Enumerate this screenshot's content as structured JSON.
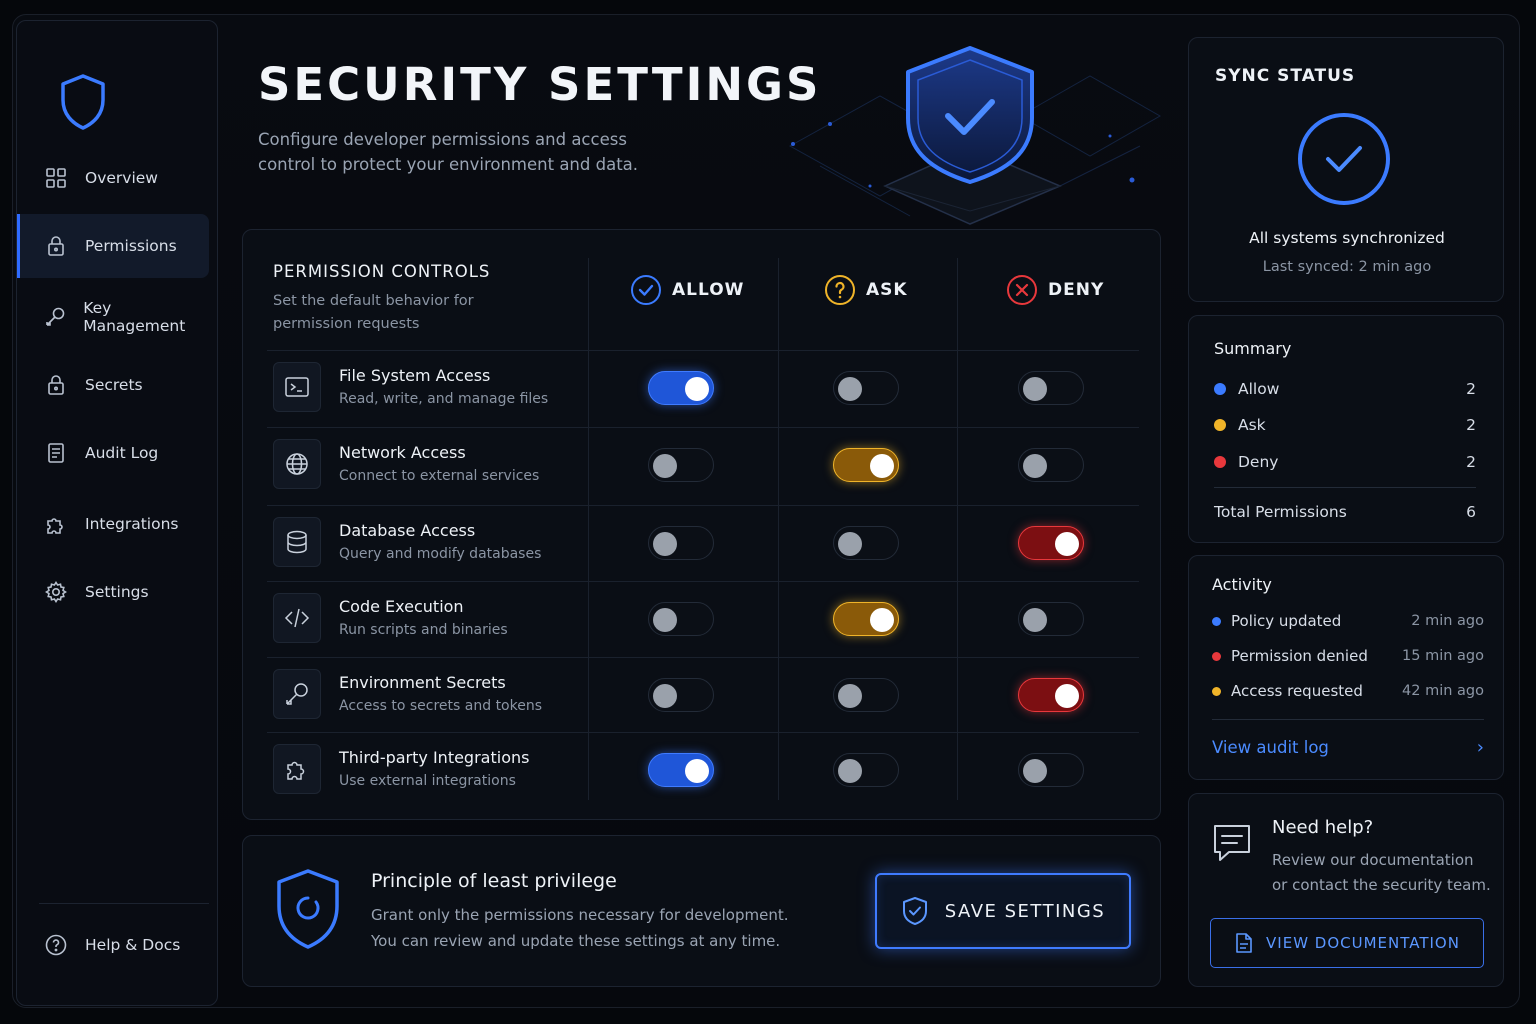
{
  "header": {
    "title": "SECURITY SETTINGS",
    "subtitle": "Configure developer permissions and access control to protect your environment and data."
  },
  "sidebar": {
    "items": [
      {
        "label": "Overview",
        "icon": "grid-icon"
      },
      {
        "label": "Permissions",
        "icon": "lock-icon",
        "active": true
      },
      {
        "label": "Key Management",
        "icon": "key-icon"
      },
      {
        "label": "Secrets",
        "icon": "lock-icon"
      },
      {
        "label": "Audit Log",
        "icon": "document-icon"
      },
      {
        "label": "Integrations",
        "icon": "puzzle-icon"
      },
      {
        "label": "Settings",
        "icon": "gear-icon"
      }
    ],
    "help_label": "Help & Docs"
  },
  "permissions": {
    "title": "PERMISSION CONTROLS",
    "subtitle": "Set the default behavior for permission requests",
    "columns": {
      "allow": "ALLOW",
      "ask": "ASK",
      "deny": "DENY"
    },
    "rows": [
      {
        "name": "File System Access",
        "desc": "Read, write, and manage files",
        "icon": "terminal-icon",
        "setting": "allow"
      },
      {
        "name": "Network Access",
        "desc": "Connect to external services",
        "icon": "globe-icon",
        "setting": "ask"
      },
      {
        "name": "Database Access",
        "desc": "Query and modify databases",
        "icon": "database-icon",
        "setting": "deny"
      },
      {
        "name": "Code Execution",
        "desc": "Run scripts and binaries",
        "icon": "code-icon",
        "setting": "ask"
      },
      {
        "name": "Environment Secrets",
        "desc": "Access to secrets and tokens",
        "icon": "key-icon",
        "setting": "deny"
      },
      {
        "name": "Third-party Integrations",
        "desc": "Use external integrations",
        "icon": "puzzle-icon",
        "setting": "allow"
      }
    ]
  },
  "info": {
    "title": "Principle of least privilege",
    "text": "Grant only the permissions necessary for development. You can review and update these settings at any time.",
    "save_label": "SAVE SETTINGS"
  },
  "sync": {
    "title": "SYNC STATUS",
    "status": "All systems synchronized",
    "last_synced": "Last synced: 2 min ago"
  },
  "summary": {
    "title": "Summary",
    "rows": [
      {
        "label": "Allow",
        "value": "2",
        "color": "#3b7bff"
      },
      {
        "label": "Ask",
        "value": "2",
        "color": "#f0b429"
      },
      {
        "label": "Deny",
        "value": "2",
        "color": "#e8383c"
      }
    ],
    "total_label": "Total Permissions",
    "total_value": "6"
  },
  "activity": {
    "title": "Activity",
    "items": [
      {
        "label": "Policy updated",
        "time": "2 min ago",
        "color": "#3b7bff"
      },
      {
        "label": "Permission denied",
        "time": "15 min ago",
        "color": "#e8383c"
      },
      {
        "label": "Access requested",
        "time": "42 min ago",
        "color": "#f0b429"
      }
    ],
    "link_label": "View audit log"
  },
  "help": {
    "title": "Need help?",
    "text": "Review our documentation or contact the security team.",
    "button_label": "VIEW DOCUMENTATION"
  },
  "colors": {
    "accent": "#3b7bff",
    "ask": "#f0b429",
    "deny": "#e8383c",
    "background": "#05070b"
  }
}
